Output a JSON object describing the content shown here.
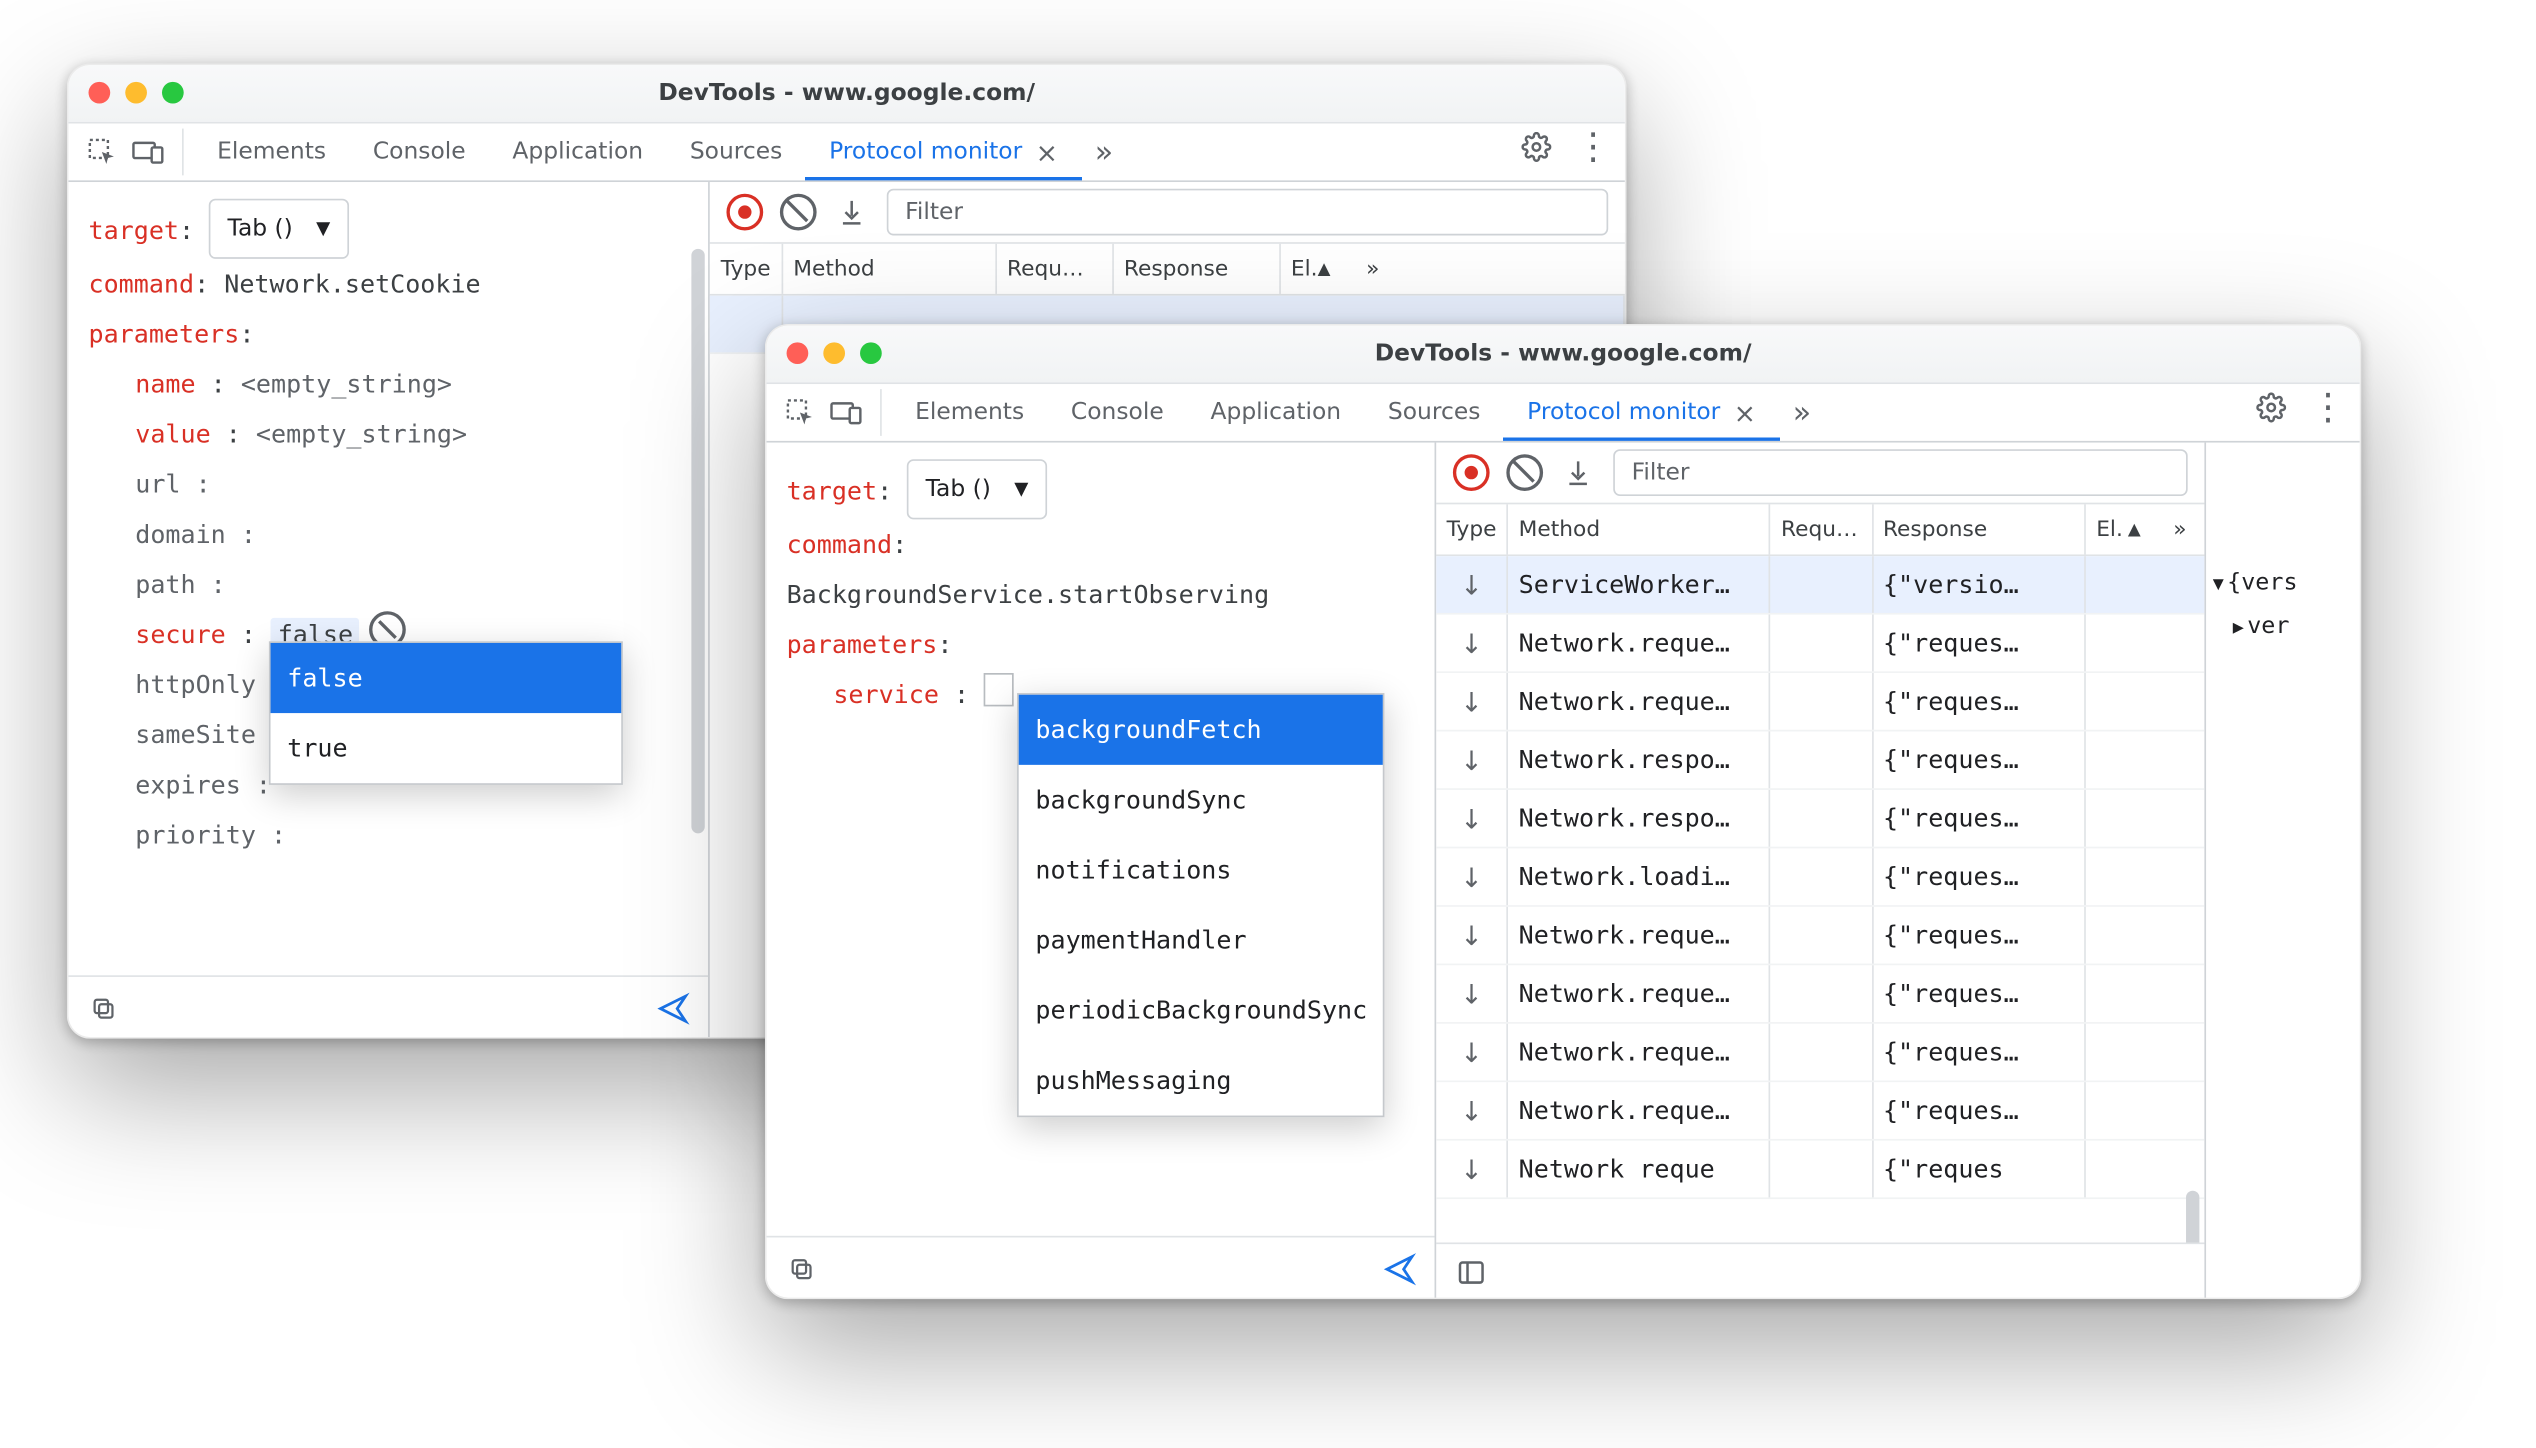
{
  "windowA": {
    "title": "DevTools - www.google.com/",
    "tabs": [
      "Elements",
      "Console",
      "Application",
      "Sources",
      "Protocol monitor"
    ],
    "activeTab": "Protocol monitor",
    "target_label": "target",
    "target_select": "Tab ()",
    "command_label": "command",
    "command_value": "Network.setCookie",
    "parameters_label": "parameters",
    "params": [
      {
        "key": "name",
        "value": "<empty_string>",
        "placeholder": true
      },
      {
        "key": "value",
        "value": "<empty_string>",
        "placeholder": true
      },
      {
        "key": "url",
        "value": ""
      },
      {
        "key": "domain",
        "value": ""
      },
      {
        "key": "path",
        "value": ""
      },
      {
        "key": "secure",
        "value": "false",
        "editing": true
      },
      {
        "key": "httpOnly",
        "value": ""
      },
      {
        "key": "sameSite",
        "value": ""
      },
      {
        "key": "expires",
        "value": ""
      },
      {
        "key": "priority",
        "value": ""
      }
    ],
    "autocomplete": [
      "false",
      "true"
    ],
    "autocompleteSelected": 0,
    "headers": {
      "type": "Type",
      "method": "Method",
      "req": "Requ…",
      "resp": "Response",
      "el": "El.",
      "more": "»"
    },
    "filter_placeholder": "Filter"
  },
  "windowB": {
    "title": "DevTools - www.google.com/",
    "tabs": [
      "Elements",
      "Console",
      "Application",
      "Sources",
      "Protocol monitor"
    ],
    "activeTab": "Protocol monitor",
    "target_label": "target",
    "target_select": "Tab ()",
    "command_label": "command",
    "command_value": "BackgroundService.startObserving",
    "parameters_label": "parameters",
    "param_key": "service",
    "autocomplete": [
      "backgroundFetch",
      "backgroundSync",
      "notifications",
      "paymentHandler",
      "periodicBackgroundSync",
      "pushMessaging"
    ],
    "autocompleteSelected": 0,
    "headers": {
      "type": "Type",
      "method": "Method",
      "req": "Requ…",
      "resp": "Response",
      "el": "El.",
      "more": "»"
    },
    "filter_placeholder": "Filter",
    "rows": [
      {
        "method": "ServiceWorker…",
        "resp": "{\"versio…",
        "sel": true
      },
      {
        "method": "Network.reque…",
        "resp": "{\"reques…"
      },
      {
        "method": "Network.reque…",
        "resp": "{\"reques…"
      },
      {
        "method": "Network.respo…",
        "resp": "{\"reques…"
      },
      {
        "method": "Network.respo…",
        "resp": "{\"reques…"
      },
      {
        "method": "Network.loadi…",
        "resp": "{\"reques…"
      },
      {
        "method": "Network.reque…",
        "resp": "{\"reques…"
      },
      {
        "method": "Network.reque…",
        "resp": "{\"reques…"
      },
      {
        "method": "Network.reque…",
        "resp": "{\"reques…"
      },
      {
        "method": "Network.reque…",
        "resp": "{\"reques…"
      },
      {
        "method": "Network reque",
        "resp": "{\"reques"
      }
    ],
    "json_panel": {
      "root": "{vers",
      "child": "ver"
    }
  }
}
